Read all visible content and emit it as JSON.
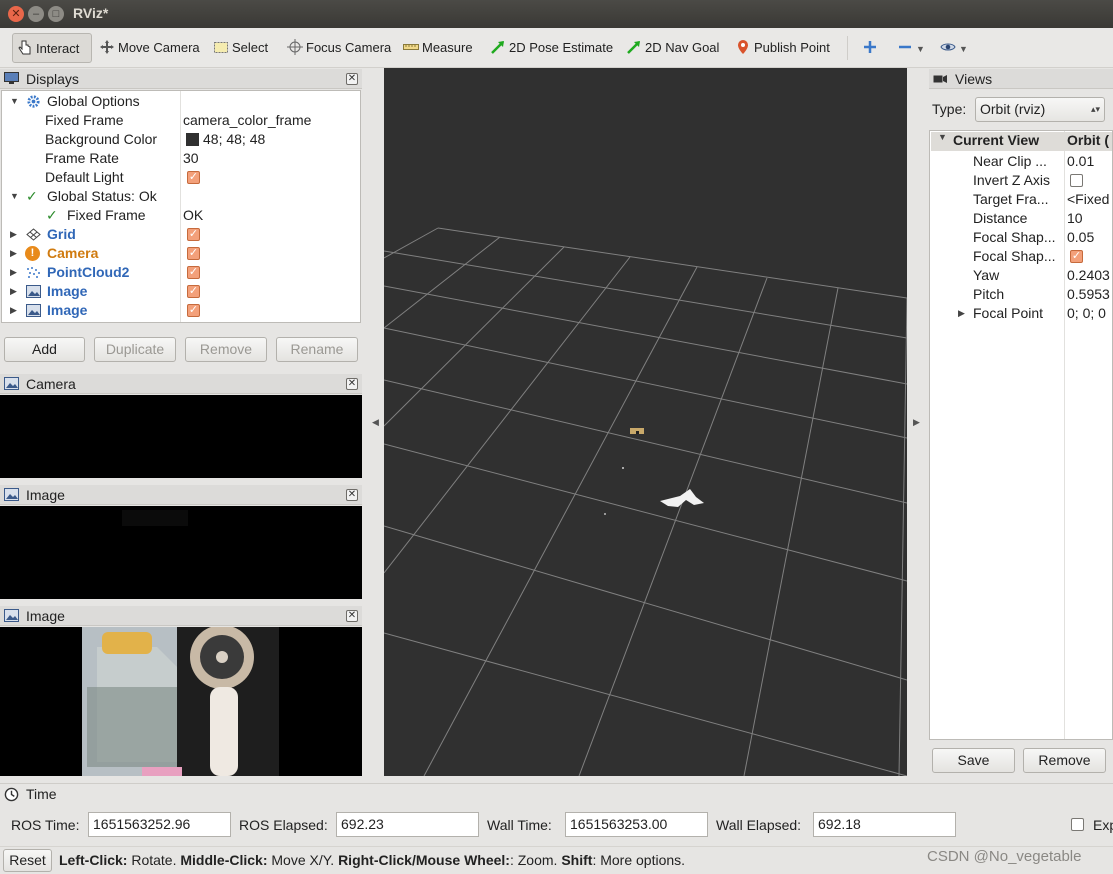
{
  "window": {
    "title": "RViz*"
  },
  "toolbar": {
    "interact": "Interact",
    "move_camera": "Move Camera",
    "select": "Select",
    "focus_camera": "Focus Camera",
    "measure": "Measure",
    "pose_estimate": "2D Pose Estimate",
    "nav_goal": "2D Nav Goal",
    "publish_point": "Publish Point"
  },
  "displays": {
    "title": "Displays",
    "rows": [
      {
        "name": "Global Options",
        "value": ""
      },
      {
        "name": "Fixed Frame",
        "value": "camera_color_frame"
      },
      {
        "name": "Background Color",
        "value": "48; 48; 48"
      },
      {
        "name": "Frame Rate",
        "value": "30"
      },
      {
        "name": "Default Light",
        "value": ""
      },
      {
        "name": "Global Status: Ok",
        "value": ""
      },
      {
        "name": "Fixed Frame",
        "value": "OK"
      },
      {
        "name": "Grid",
        "value": ""
      },
      {
        "name": "Camera",
        "value": ""
      },
      {
        "name": "PointCloud2",
        "value": ""
      },
      {
        "name": "Image",
        "value": ""
      },
      {
        "name": "Image",
        "value": ""
      }
    ],
    "buttons": {
      "add": "Add",
      "duplicate": "Duplicate",
      "remove": "Remove",
      "rename": "Rename"
    }
  },
  "camera_panel": {
    "title": "Camera"
  },
  "image_panel_1": {
    "title": "Image"
  },
  "image_panel_2": {
    "title": "Image"
  },
  "views": {
    "title": "Views",
    "type_label": "Type:",
    "type_value": "Orbit (rviz)",
    "header": {
      "name": "Current View",
      "value": "Orbit ("
    },
    "rows": [
      {
        "name": "Near Clip ...",
        "value": "0.01"
      },
      {
        "name": "Invert Z Axis",
        "value": ""
      },
      {
        "name": "Target Fra...",
        "value": "<Fixed"
      },
      {
        "name": "Distance",
        "value": "10"
      },
      {
        "name": "Focal Shap...",
        "value": "0.05"
      },
      {
        "name": "Focal Shap...",
        "value": ""
      },
      {
        "name": "Yaw",
        "value": "0.2403"
      },
      {
        "name": "Pitch",
        "value": "0.5953"
      },
      {
        "name": "Focal Point",
        "value": "0; 0; 0"
      }
    ],
    "buttons": {
      "save": "Save",
      "remove": "Remove"
    }
  },
  "time": {
    "title": "Time",
    "ros_time_label": "ROS Time:",
    "ros_time": "1651563252.96",
    "ros_elapsed_label": "ROS Elapsed:",
    "ros_elapsed": "692.23",
    "wall_time_label": "Wall Time:",
    "wall_time": "1651563253.00",
    "wall_elapsed_label": "Wall Elapsed:",
    "wall_elapsed": "692.18",
    "experimental_label": "Exp"
  },
  "status": {
    "reset": "Reset",
    "left_click": "Left-Click:",
    "left_click_desc": " Rotate. ",
    "middle_click": "Middle-Click:",
    "middle_click_desc": " Move X/Y. ",
    "right_click": "Right-Click/Mouse Wheel:",
    "right_click_desc": ": Zoom. ",
    "shift": "Shift",
    "shift_desc": ": More options.",
    "watermark": "CSDN @No_vegetable"
  },
  "colors": {
    "background": "#303030",
    "grid": "#a0a0a0",
    "checkbox": "#f3a07a",
    "display_name_blue": "#3067b7",
    "camera_orange": "#d07b10"
  }
}
